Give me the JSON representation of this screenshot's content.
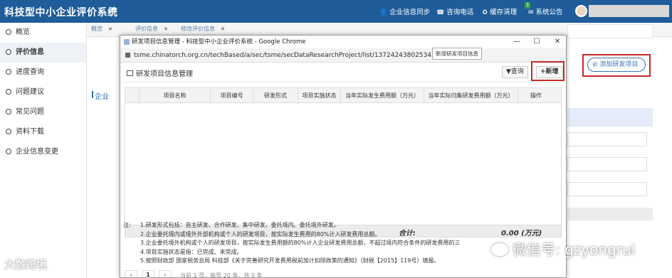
{
  "topbar": {
    "title": "科技型中小企业评价系统",
    "menu_icon": "≡",
    "nav": [
      {
        "label": "企业信息同步",
        "icon": "person-icon",
        "glyph": "👤"
      },
      {
        "label": "咨询电话",
        "icon": "phone-icon",
        "glyph": "☎"
      },
      {
        "label": "缓存清理",
        "icon": "recycle-icon",
        "glyph": "♻"
      },
      {
        "label": "系统公告",
        "icon": "mail-icon",
        "glyph": "✉",
        "badge": "1"
      }
    ]
  },
  "sidebar": {
    "items": [
      {
        "label": "概览"
      },
      {
        "label": "评价信息",
        "active": true
      },
      {
        "label": "进度查询"
      },
      {
        "label": "问题建议"
      },
      {
        "label": "常见问题"
      },
      {
        "label": "资料下载"
      },
      {
        "label": "企业信息变更"
      }
    ]
  },
  "tabs": [
    {
      "label": "概览"
    },
    {
      "label": "评价信息"
    },
    {
      "label": "修改评价信息"
    }
  ],
  "background": {
    "section_label": "企业",
    "add_button": "添加研发项目",
    "add_icon": "⊘"
  },
  "popup": {
    "window_title": "研发项目信息管理 - 科技型中小企业评价系统 - Google Chrome",
    "url": "tsme.chinatorch.org.cn/techBased/a/sec/tsme/secDataResearchProject/list/1372424380253454336",
    "controls": {
      "minimize": "—",
      "maximize": "☐",
      "close": "✕"
    },
    "header_title": "研发项目信息管理",
    "query_button": "查询",
    "query_icon": "▼",
    "new_button": "新增",
    "new_icon": "+",
    "tooltip": "新增研发项目信息",
    "columns": [
      "项目名称",
      "项目编号",
      "研发形式",
      "项目实施状态",
      "当年实际发生费用额（万元）",
      "当年实际归集研发费用额（万元）",
      "操作"
    ],
    "sum_label": "合计:",
    "sum_value": "0.00 (万元)",
    "notes_label": "注:",
    "notes": [
      "1.研发形式包括：自主研发、合作研发、集中研发、委托境内、委托境外研发。",
      "2.企业委托境内或境外外部机构或个人的研发项目，按实际发生费用的80%计入研发费用总额。",
      "3.企业委托境外机构或个人的研发项目，按实际发生费用额的80%计入企业研发费用总额，不超过境内符合条件的研发费用的三",
      "4.项目实施状态是指：已完成、未完成。",
      "5.按照财政部 国家税务总局 科技部《关于完善研究开发费用税前加计扣除政策的通知》（财税【2015】119号）填报。"
    ],
    "pager": {
      "prev": "‹",
      "page": "1",
      "next": "›",
      "info": "当前 1 页，每页 20 条，共 0 条"
    }
  },
  "watermarks": {
    "left": "大数跨境",
    "right": "微信号: gzyongrui"
  }
}
